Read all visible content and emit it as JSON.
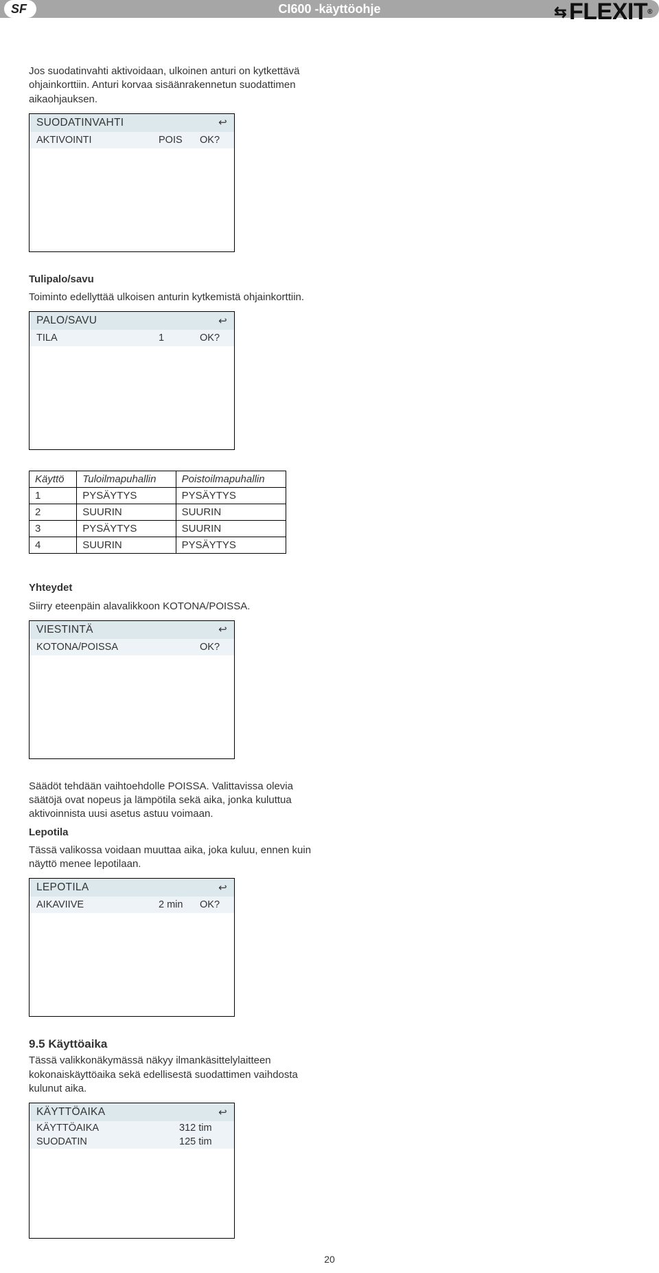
{
  "header": {
    "lang_badge": "SF",
    "doc_title": "CI600 -käyttöohje",
    "logo_text": "FLEXIT",
    "logo_reg": "®"
  },
  "left": {
    "intro": "Jos suodatinvahti aktivoidaan, ulkoinen anturi on kytkettävä ohjainkorttiin. Anturi korvaa sisäänrakennetun suodattimen aikaohjauksen.",
    "panel1": {
      "title": "SUODATINVAHTI",
      "row": {
        "label": "AKTIVOINTI",
        "value": "POIS",
        "ok": "OK?"
      }
    },
    "fire_heading": "Tulipalo/savu",
    "fire_text": "Toiminto edellyttää ulkoisen anturin kytkemistä ohjainkorttiin.",
    "panel2": {
      "title": "PALO/SAVU",
      "row": {
        "label": "TILA",
        "value": "1",
        "ok": "OK?"
      }
    },
    "table": {
      "headers": [
        "Käyttö",
        "Tuloilmapuhallin",
        "Poistoilmapuhallin"
      ],
      "rows": [
        [
          "1",
          "PYSÄYTYS",
          "PYSÄYTYS"
        ],
        [
          "2",
          "SUURIN",
          "SUURIN"
        ],
        [
          "3",
          "PYSÄYTYS",
          "SUURIN"
        ],
        [
          "4",
          "SUURIN",
          "PYSÄYTYS"
        ]
      ]
    }
  },
  "right": {
    "conn_heading": "Yhteydet",
    "conn_text": "Siirry eteenpäin alavalikkoon KOTONA/POISSA.",
    "panel3": {
      "title": "VIESTINTÄ",
      "row": {
        "label": "KOTONA/POISSA",
        "value": "",
        "ok": "OK?"
      }
    },
    "settings_text": "Säädöt tehdään vaihtoehdolle POISSA. Valittavissa olevia säätöjä ovat nopeus ja lämpötila sekä aika, jonka kuluttua aktivoinnista uusi asetus astuu voimaan.",
    "lepo_heading": "Lepotila",
    "lepo_text": "Tässä valikossa voidaan muuttaa aika, joka kuluu, ennen kuin näyttö menee lepotilaan.",
    "panel4": {
      "title": "LEPOTILA",
      "row": {
        "label": "AIKAVIIVE",
        "value": "2 min",
        "ok": "OK?"
      }
    },
    "sect95_title": "9.5  Käyttöaika",
    "sect95_text": "Tässä valikkonäkymässä näkyy ilmankäsittelylaitteen kokonaiskäyttöaika sekä edellisestä suodattimen vaihdosta kulunut aika.",
    "panel5": {
      "title": "KÄYTTÖAIKA",
      "rows": [
        {
          "label": "KÄYTTÖAIKA",
          "value": "312 tim"
        },
        {
          "label": "SUODATIN",
          "value": "125 tim"
        }
      ]
    }
  },
  "page_number": "20",
  "icons": {
    "back": "↩"
  }
}
